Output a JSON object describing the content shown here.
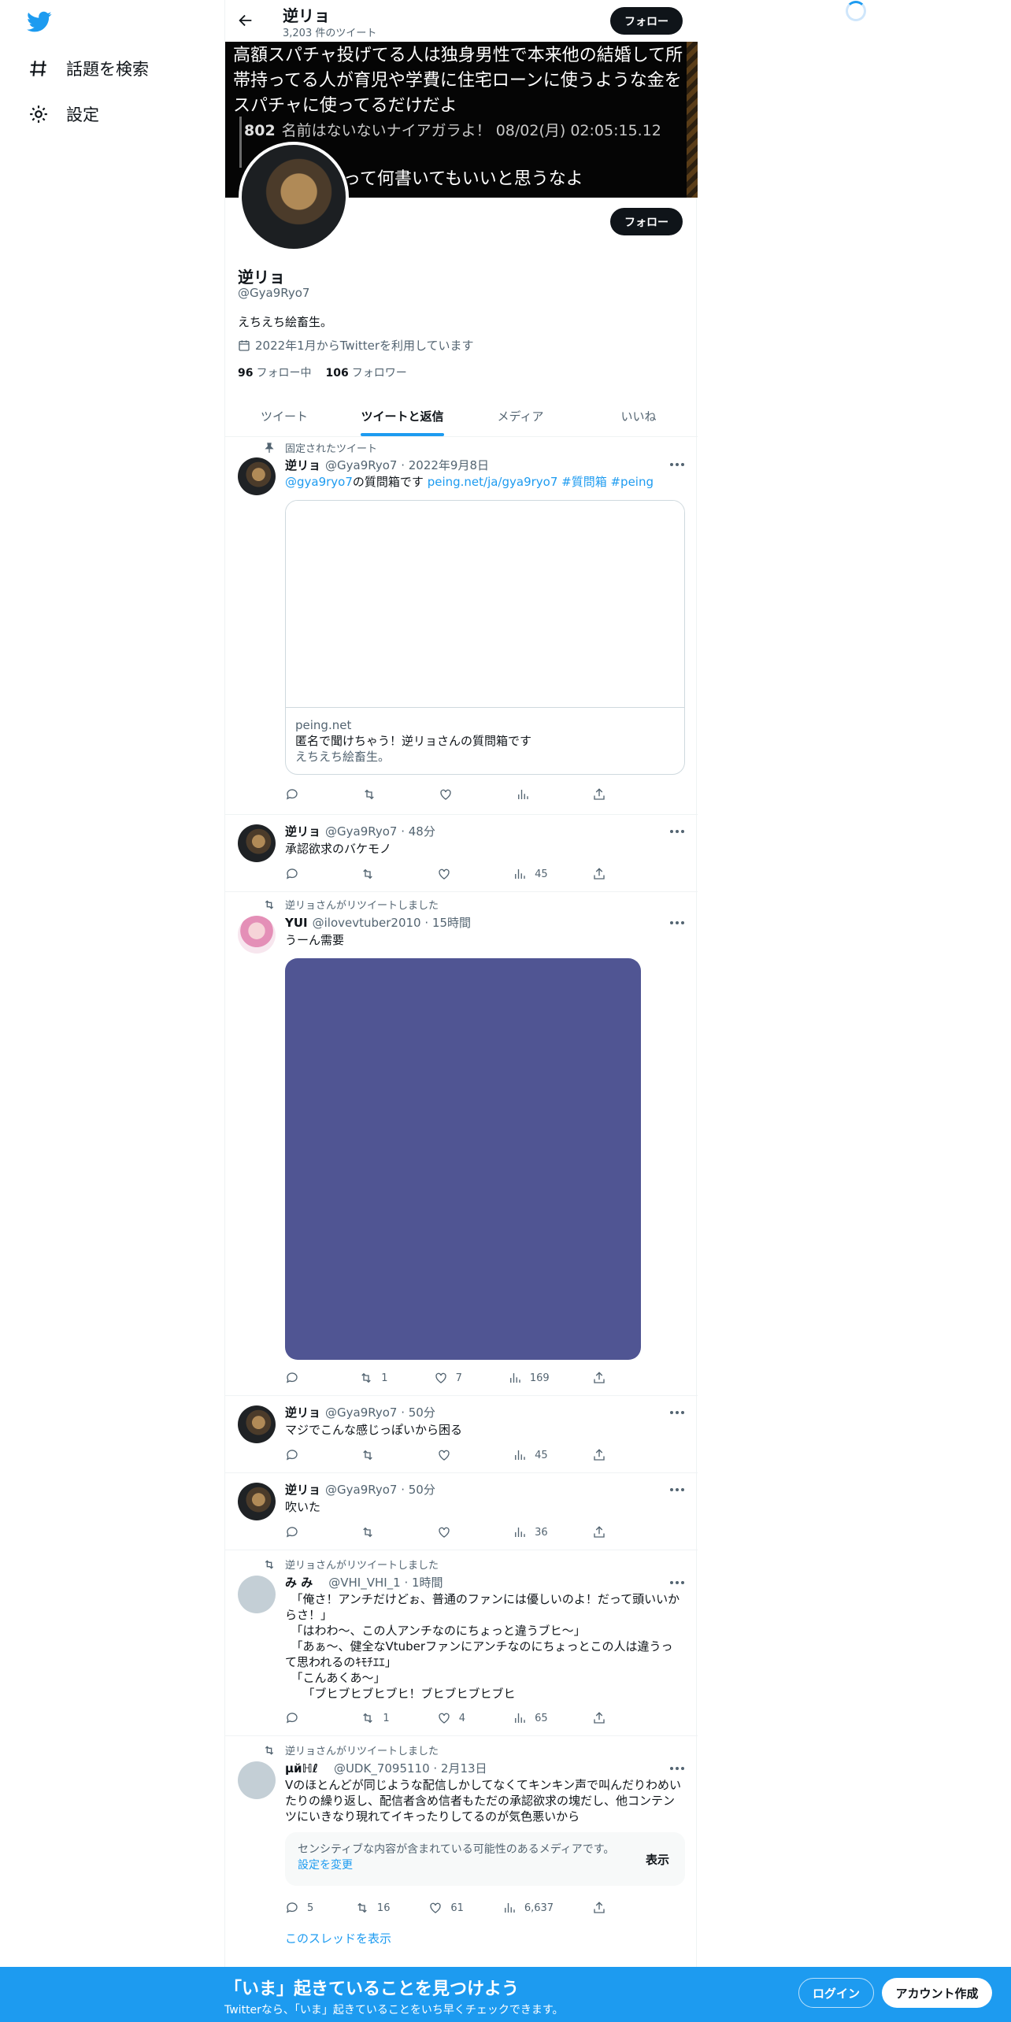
{
  "nav": {
    "explore_label": "話題を検索",
    "settings_label": "設定"
  },
  "header": {
    "name": "逆リョ",
    "tweet_count": "3,203 件のツイート",
    "follow_label": "フォロー"
  },
  "banner": {
    "text1": "高額スパチャ投げてる人は独身男性で本来他の結婚して所帯持ってる人が育児や学費に住宅ローンに使うような金をスパチャに使ってるだけだよ",
    "post_no": "802",
    "meta": "名前はないないナイアガラよ！ 08/02(月) 02:05:15.12",
    "text2": "って何書いてもいいと思うなよ"
  },
  "profile": {
    "name": "逆リョ",
    "handle": "@Gya9Ryo7",
    "bio": "えちえち絵畜生。",
    "joined": "2022年1月からTwitterを利用しています",
    "following_count": "96",
    "following_label": "フォロー中",
    "followers_count": "106",
    "followers_label": "フォロワー",
    "follow_label": "フォロー"
  },
  "tabs": [
    "ツイート",
    "ツイートと返信",
    "メディア",
    "いいね"
  ],
  "tweets": [
    {
      "social": "固定されたツイート",
      "name": "逆リョ",
      "meta": "@Gya9Ryo7 · 2022年9月8日",
      "text_link1": "@gya9ryo7",
      "text_mid": "の質問箱です ",
      "text_link2": "peing.net/ja/gya9ryo7 #質問箱 #peing",
      "card_domain": "peing.net",
      "card_title": "匿名で聞けちゃう！逆リョさんの質問箱です",
      "card_desc": "えちえち絵畜生。",
      "retweets": "",
      "likes": "",
      "views": ""
    },
    {
      "name": "逆リョ",
      "meta": "@Gya9Ryo7 · 48分",
      "text": "承認欲求のバケモノ",
      "views": "45"
    },
    {
      "social": "逆リョさんがリツイートしました",
      "name": "YUI",
      "meta": "@ilovevtuber2010 · 15時間",
      "text": "うーん需要",
      "retweets": "1",
      "likes": "7",
      "views": "169"
    },
    {
      "name": "逆リョ",
      "meta": "@Gya9Ryo7 · 50分",
      "text": "マジでこんな感じっぽいから困る",
      "views": "45"
    },
    {
      "name": "逆リョ",
      "meta": "@Gya9Ryo7 · 50分",
      "text": "吹いた",
      "views": "36"
    },
    {
      "social": "逆リョさんがリツイートしました",
      "name": "み み",
      "meta": "@VHI_VHI_1 · 1時間",
      "text": "　「俺さ！アンチだけどぉ、普通のファンには優しいのよ！だって頭いいからさ！」\n　「はわわ〜、この人アンチなのにちょっと違うブヒ〜」\n　「あぁ〜、健全なVtuberファンにアンチなのにちょっとこの人は違うって思われるのｷﾓﾁｴｴ」\n　「こんあくあ〜」\n　　「ブヒブヒブヒブヒ！ブヒブヒブヒブヒ",
      "retweets": "1",
      "likes": "4",
      "views": "65"
    },
    {
      "social": "逆リョさんがリツイートしました",
      "name": "μйℍℓ",
      "meta": "@UDK_7095110 · 2月13日",
      "text": "Vのほとんどが同じような配信しかしてなくてキンキン声で叫んだりわめいたりの繰り返し、配信者含め信者もただの承認欲求の塊だし、他コンテンツにいきなり現れてイキったりしてるのが気色悪いから",
      "sensitive_msg": "センシティブな内容が含まれている可能性のあるメディアです。",
      "sensitive_link": "設定を変更",
      "sensitive_show": "表示",
      "replies": "5",
      "retweets": "16",
      "likes": "61",
      "views": "6,637",
      "thread_link": "このスレッドを表示"
    }
  ],
  "bottom": {
    "title": "「いま」起きていることを見つけよう",
    "subtitle": "Twitterなら、「いま」起きていることをいち早くチェックできます。",
    "login": "ログイン",
    "signup": "アカウント作成"
  },
  "colors": {
    "accent": "#1d9bf0",
    "media": "#505593"
  }
}
